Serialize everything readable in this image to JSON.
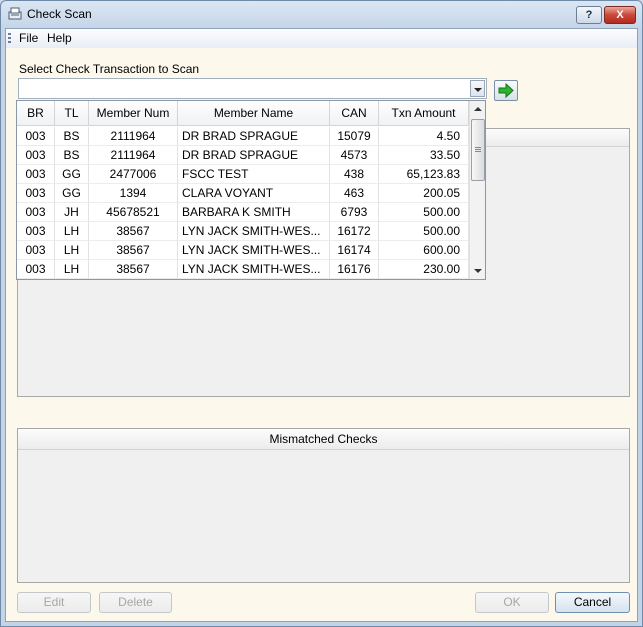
{
  "window": {
    "title": "Check Scan",
    "help_label": "?",
    "close_label": "X"
  },
  "menu": {
    "file": "File",
    "help": "Help"
  },
  "select": {
    "label": "Select Check Transaction to Scan",
    "value": ""
  },
  "grid": {
    "columns": [
      "BR",
      "TL",
      "Member Num",
      "Member Name",
      "CAN",
      "Txn Amount"
    ],
    "rows": [
      [
        "003",
        "BS",
        "2111964",
        "DR BRAD SPRAGUE",
        "15079",
        "4.50"
      ],
      [
        "003",
        "BS",
        "2111964",
        "DR BRAD SPRAGUE",
        "4573",
        "33.50"
      ],
      [
        "003",
        "GG",
        "2477006",
        "FSCC TEST",
        "438",
        "65,123.83"
      ],
      [
        "003",
        "GG",
        "1394",
        "CLARA VOYANT",
        "463",
        "200.05"
      ],
      [
        "003",
        "JH",
        "45678521",
        "BARBARA K SMITH",
        "6793",
        "500.00"
      ],
      [
        "003",
        "LH",
        "38567",
        "LYN JACK SMITH-WES...",
        "16172",
        "500.00"
      ],
      [
        "003",
        "LH",
        "38567",
        "LYN JACK SMITH-WES...",
        "16174",
        "600.00"
      ],
      [
        "003",
        "LH",
        "38567",
        "LYN JACK SMITH-WES...",
        "16176",
        "230.00"
      ]
    ]
  },
  "mismatch_panel": {
    "title": "Mismatched Checks"
  },
  "buttons": {
    "edit": "Edit",
    "delete": "Delete",
    "ok": "OK",
    "cancel": "Cancel"
  },
  "icons": {
    "go": "green-arrow-right-icon",
    "app": "scanner-icon"
  },
  "colors": {
    "go_arrow": "#2bb52b",
    "background": "#fcf8ec"
  }
}
